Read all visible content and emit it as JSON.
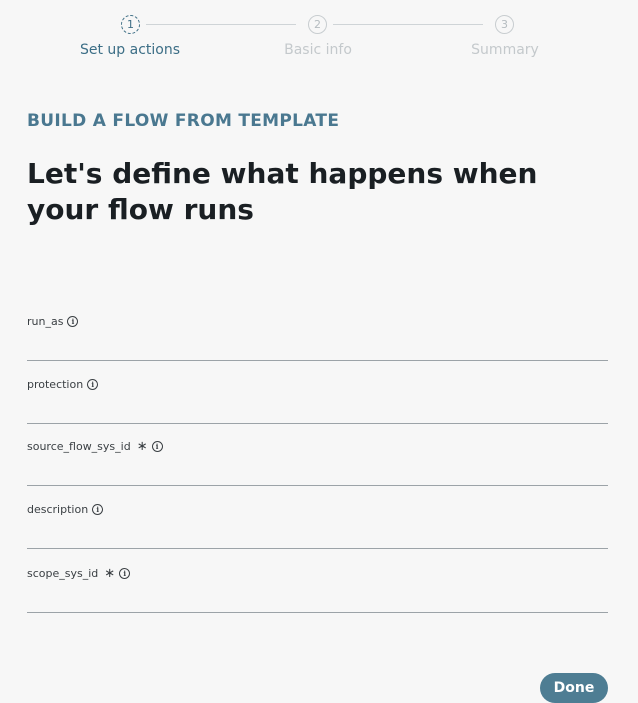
{
  "stepper": {
    "steps": [
      {
        "number": "1",
        "label": "Set up actions"
      },
      {
        "number": "2",
        "label": "Basic info"
      },
      {
        "number": "3",
        "label": "Summary"
      }
    ],
    "active_step": 1
  },
  "header": {
    "eyebrow": "BUILD A FLOW FROM TEMPLATE",
    "title": "Let's define what happens when your flow runs"
  },
  "form": {
    "fields": [
      {
        "label": "run_as",
        "required": false,
        "value": ""
      },
      {
        "label": "protection",
        "required": false,
        "value": ""
      },
      {
        "label": "source_flow_sys_id",
        "required": true,
        "value": ""
      },
      {
        "label": "description",
        "required": false,
        "value": ""
      },
      {
        "label": "scope_sys_id",
        "required": true,
        "value": ""
      }
    ],
    "required_marker": "∗",
    "info_icon": "info-circle-icon"
  },
  "footer": {
    "done_label": "Done"
  },
  "colors": {
    "accent": "#4e7d93",
    "eyebrow": "#4a7890",
    "inactive_step": "#c4c9cc",
    "background": "#f7f7f7"
  }
}
